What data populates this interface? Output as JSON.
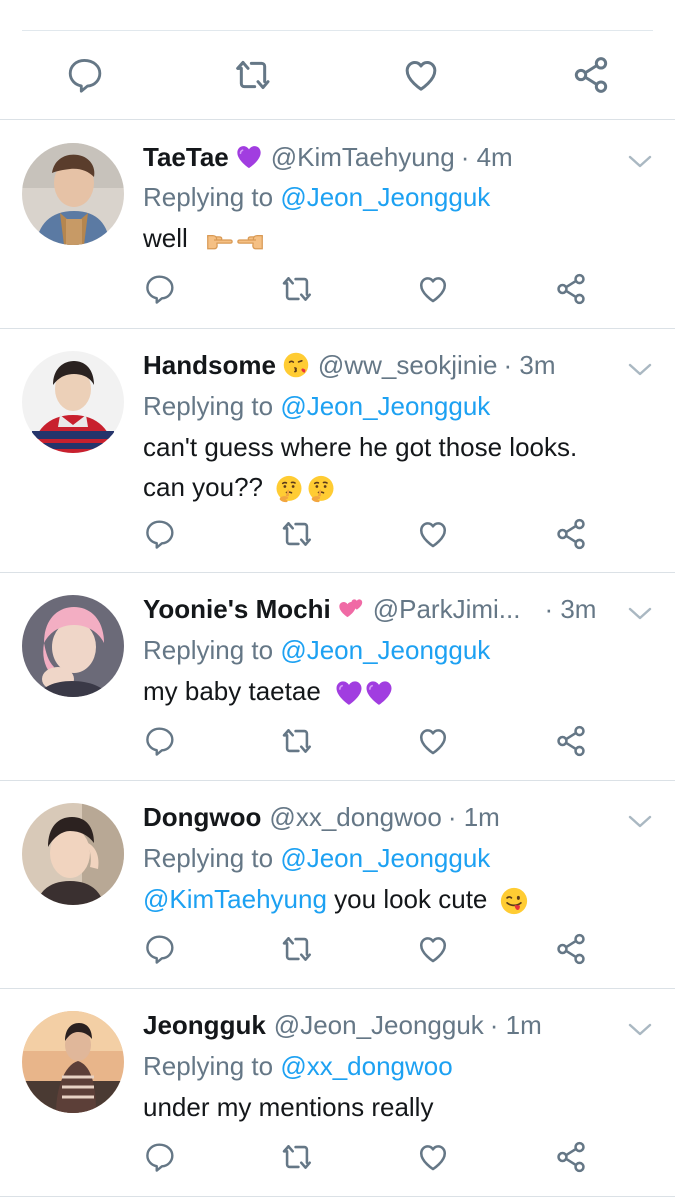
{
  "colors": {
    "text": "#14171a",
    "secondary": "#657786",
    "link": "#1da1f2",
    "divider": "#dbe1e6",
    "icon": "#657786"
  },
  "top_actions": {
    "icons": [
      "reply-icon",
      "retweet-icon",
      "like-icon",
      "share-icon"
    ]
  },
  "tweets": [
    {
      "display_name": "TaeTae",
      "name_emoji": "purple-heart-icon",
      "handle": "@KimTaehyung",
      "time": "· 4m",
      "replying_prefix": "Replying to",
      "replying_to": "@Jeon_Jeongguk",
      "text_line1": "well",
      "text_emojis": [
        "hand-pointing-right-icon",
        "hand-pointing-left-icon"
      ]
    },
    {
      "display_name": "Handsome",
      "name_emoji": "face-blowing-kiss-icon",
      "handle": "@ww_seokjinie",
      "time": "· 3m",
      "replying_prefix": "Replying to",
      "replying_to": "@Jeon_Jeongguk",
      "text_line1": "can't guess where he got those looks.",
      "text_line2": "can you??",
      "text_emojis": [
        "thinking-face-icon",
        "thinking-face-icon"
      ]
    },
    {
      "display_name": "Yoonie's Mochi",
      "name_emoji": "two-hearts-icon",
      "handle": "@ParkJimi...",
      "time": "· 3m",
      "replying_prefix": "Replying to",
      "replying_to": "@Jeon_Jeongguk",
      "text_line1": "my baby taetae",
      "text_emojis": [
        "purple-heart-icon",
        "purple-heart-icon"
      ]
    },
    {
      "display_name": "Dongwoo",
      "handle": "@xx_dongwoo",
      "time": "· 1m",
      "replying_prefix": "Replying to",
      "replying_to": "@Jeon_Jeongguk",
      "text_mention": "@KimTaehyung",
      "text_line1": "you look cute",
      "text_emojis": [
        "winking-face-tongue-icon"
      ]
    },
    {
      "display_name": "Jeongguk",
      "handle": "@Jeon_Jeongguk",
      "time": "· 1m",
      "replying_prefix": "Replying to",
      "replying_to": "@xx_dongwoo",
      "text_line1": "under my mentions really"
    }
  ]
}
